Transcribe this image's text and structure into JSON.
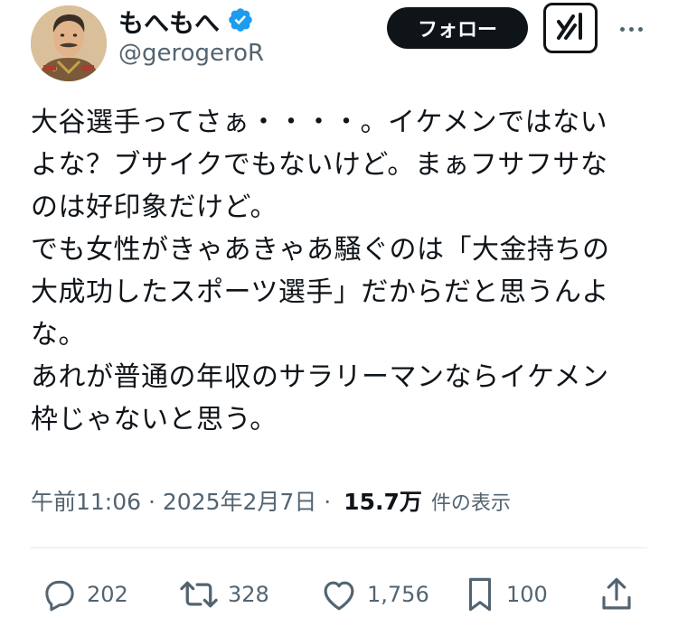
{
  "author": {
    "display_name": "もへもへ",
    "handle": "@gerogeroR"
  },
  "header": {
    "follow_label": "フォロー"
  },
  "tweet": {
    "text": "大谷選手ってさぁ・・・・。イケメンではない\nよな？ブサイクでもないけど。まぁフサフサな\nのは好印象だけど。\nでも女性がきゃあきゃあ騒ぐのは「大金持ちの\n大成功したスポーツ選手」だからだと思うんよ\nな。\nあれが普通の年収のサラリーマンならイケメン\n枠じゃないと思う。",
    "time": "午前11:06",
    "separator1": " · ",
    "date": "2025年2月7日",
    "separator2": " · ",
    "views": "15.7万",
    "views_label": "件の表示"
  },
  "actions": {
    "replies": "202",
    "retweets": "328",
    "likes": "1,756",
    "bookmarks": "100"
  },
  "icons": {
    "verified": "verified-badge-icon",
    "grok": "grok-icon",
    "more": "more-icon",
    "reply": "reply-icon",
    "retweet": "retweet-icon",
    "like": "heart-icon",
    "bookmark": "bookmark-icon",
    "share": "share-icon"
  },
  "colors": {
    "verified": "#1d9bf0",
    "follow_bg": "#0f1419",
    "secondary_text": "#536471"
  }
}
